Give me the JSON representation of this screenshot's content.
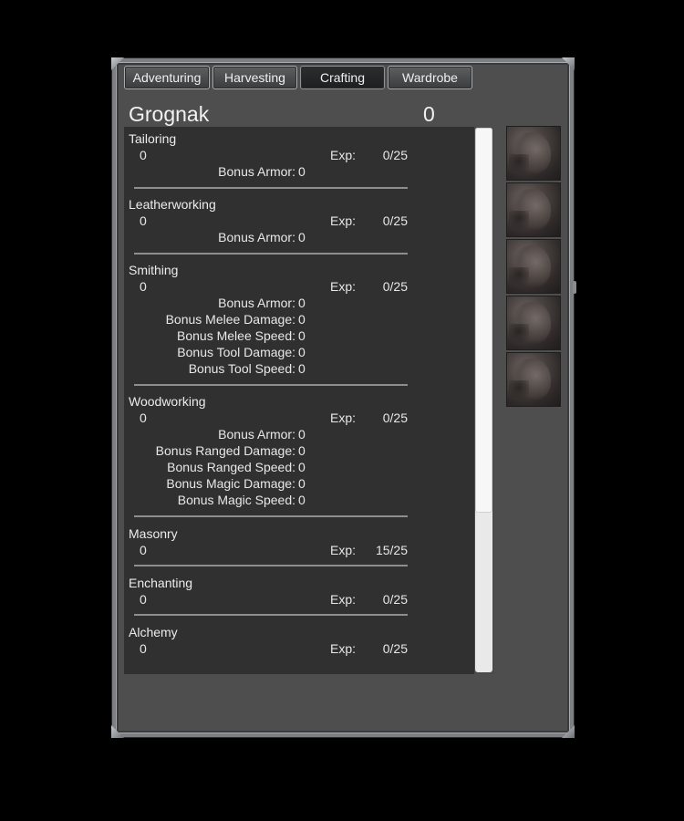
{
  "tabs": [
    {
      "label": "Adventuring",
      "active": false
    },
    {
      "label": "Harvesting",
      "active": false
    },
    {
      "label": "Crafting",
      "active": true
    },
    {
      "label": "Wardrobe",
      "active": false
    }
  ],
  "character": {
    "name": "Grognak",
    "count": "0"
  },
  "exp_label": "Exp:",
  "skills": [
    {
      "name": "Tailoring",
      "level": "0",
      "exp": "0/25",
      "bonuses": [
        {
          "label": "Bonus Armor:",
          "value": "0"
        }
      ]
    },
    {
      "name": "Leatherworking",
      "level": "0",
      "exp": "0/25",
      "bonuses": [
        {
          "label": "Bonus Armor:",
          "value": "0"
        }
      ]
    },
    {
      "name": "Smithing",
      "level": "0",
      "exp": "0/25",
      "bonuses": [
        {
          "label": "Bonus Armor:",
          "value": "0"
        },
        {
          "label": "Bonus Melee Damage:",
          "value": "0"
        },
        {
          "label": "Bonus Melee Speed:",
          "value": "0"
        },
        {
          "label": "Bonus Tool Damage:",
          "value": "0"
        },
        {
          "label": "Bonus Tool Speed:",
          "value": "0"
        }
      ]
    },
    {
      "name": "Woodworking",
      "level": "0",
      "exp": "0/25",
      "bonuses": [
        {
          "label": "Bonus Armor:",
          "value": "0"
        },
        {
          "label": "Bonus Ranged Damage:",
          "value": "0"
        },
        {
          "label": "Bonus Ranged Speed:",
          "value": "0"
        },
        {
          "label": "Bonus Magic Damage:",
          "value": "0"
        },
        {
          "label": "Bonus Magic Speed:",
          "value": "0"
        }
      ]
    },
    {
      "name": "Masonry",
      "level": "0",
      "exp": "15/25",
      "bonuses": []
    },
    {
      "name": "Enchanting",
      "level": "0",
      "exp": "0/25",
      "bonuses": []
    },
    {
      "name": "Alchemy",
      "level": "0",
      "exp": "0/25",
      "bonuses": []
    }
  ],
  "equipment_slots": [
    "head-armor-slot",
    "chest-armor-slot",
    "legs-armor-slot",
    "hands-armor-slot",
    "feet-armor-slot"
  ],
  "colors": {
    "panel": "#303030",
    "window": "#4d4e4d",
    "border": "#7d7f82",
    "text": "#e8e8e8"
  }
}
